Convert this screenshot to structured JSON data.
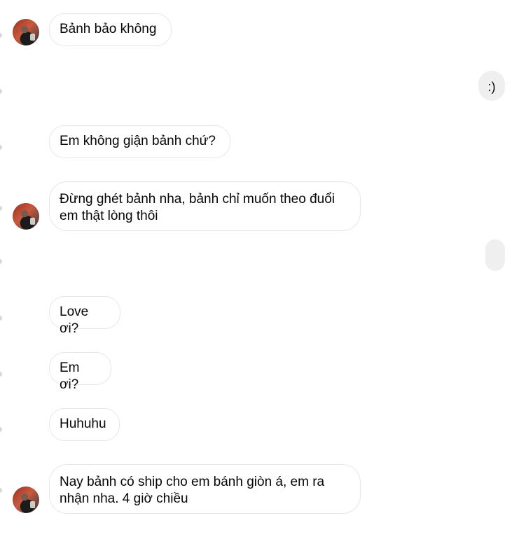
{
  "conversation": {
    "messages": [
      {
        "from": "other",
        "text": "Bảnh bảo không",
        "avatar": true
      },
      {
        "from": "self",
        "text": ":)"
      },
      {
        "from": "other",
        "text": "Em không giận bảnh chứ?",
        "avatar": false
      },
      {
        "from": "other",
        "text": "Đừng ghét bảnh nha, bảnh chỉ muốn theo đuổi em thật lòng thôi",
        "avatar": true
      },
      {
        "from": "self",
        "text": ""
      },
      {
        "from": "other",
        "text": "Love ơi?",
        "avatar": false
      },
      {
        "from": "other",
        "text": "Em ơi?",
        "avatar": false
      },
      {
        "from": "other",
        "text": "Huhuhu",
        "avatar": false
      },
      {
        "from": "other",
        "text": "Nay bảnh có ship cho em bánh giòn á, em ra nhận nha. 4 giờ chiều",
        "avatar": true
      }
    ]
  }
}
